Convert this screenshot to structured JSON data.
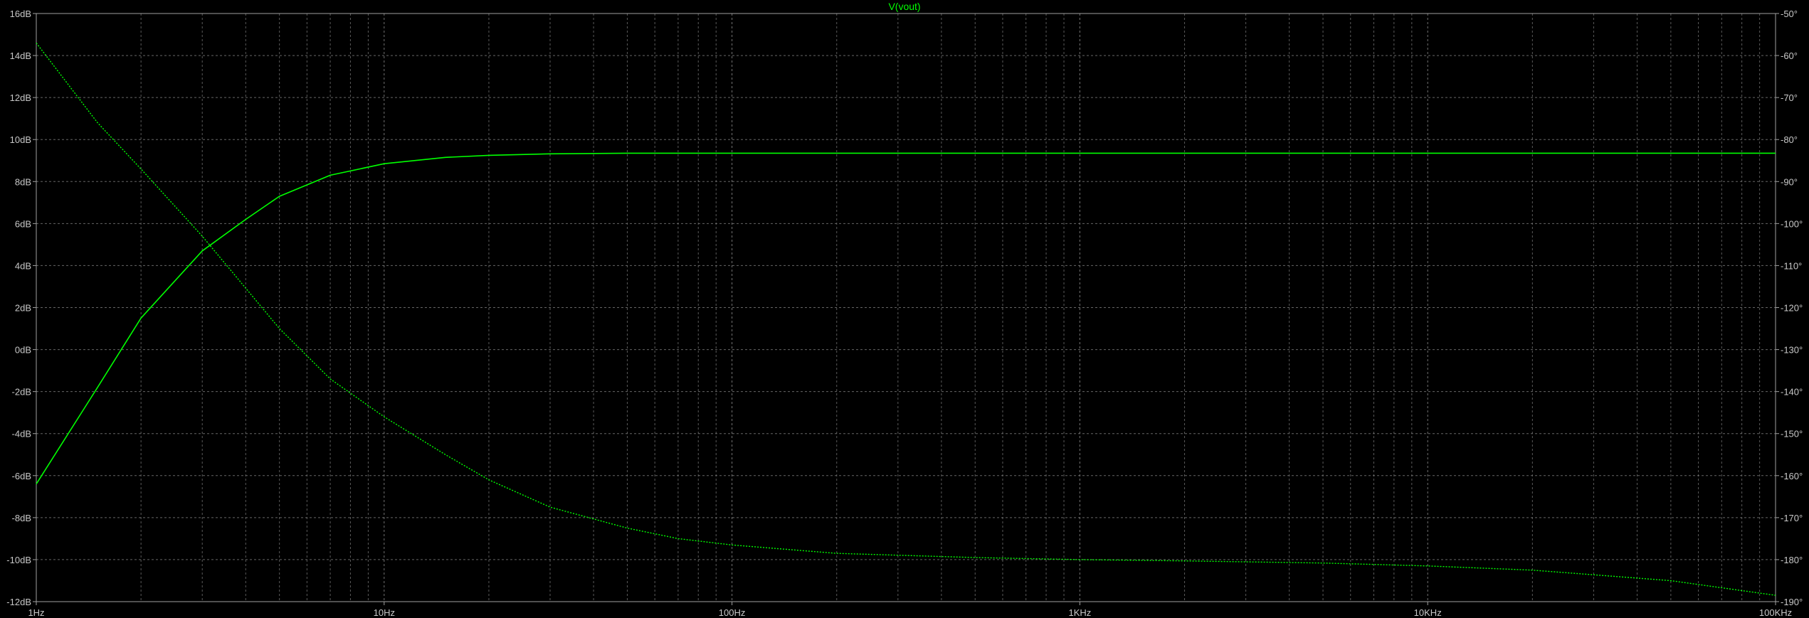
{
  "window": {
    "background": "#000000"
  },
  "colors": {
    "trace": "#00ff00",
    "grid": "#808080",
    "text": "#c8c8c8",
    "border": "#a0a0a0"
  },
  "chart_data": {
    "type": "line",
    "title": "V(vout)",
    "x_scale": "log",
    "xlim": [
      1,
      100000
    ],
    "x_ticks": [
      {
        "value": 1,
        "label": "1Hz"
      },
      {
        "value": 10,
        "label": "10Hz"
      },
      {
        "value": 100,
        "label": "100Hz"
      },
      {
        "value": 1000,
        "label": "1KHz"
      },
      {
        "value": 10000,
        "label": "10KHz"
      },
      {
        "value": 100000,
        "label": "100KHz"
      }
    ],
    "ylim_left": [
      -12,
      16
    ],
    "y_ticks_left": [
      {
        "value": 16,
        "label": "16dB"
      },
      {
        "value": 14,
        "label": "14dB"
      },
      {
        "value": 12,
        "label": "12dB"
      },
      {
        "value": 10,
        "label": "10dB"
      },
      {
        "value": 8,
        "label": "8dB"
      },
      {
        "value": 6,
        "label": "6dB"
      },
      {
        "value": 4,
        "label": "4dB"
      },
      {
        "value": 2,
        "label": "2dB"
      },
      {
        "value": 0,
        "label": "0dB"
      },
      {
        "value": -2,
        "label": "-2dB"
      },
      {
        "value": -4,
        "label": "-4dB"
      },
      {
        "value": -6,
        "label": "-6dB"
      },
      {
        "value": -8,
        "label": "-8dB"
      },
      {
        "value": -10,
        "label": "-10dB"
      },
      {
        "value": -12,
        "label": "-12dB"
      }
    ],
    "ylim_right": [
      -190,
      -50
    ],
    "y_ticks_right": [
      {
        "value": -50,
        "label": "-50°"
      },
      {
        "value": -60,
        "label": "-60°"
      },
      {
        "value": -70,
        "label": "-70°"
      },
      {
        "value": -80,
        "label": "-80°"
      },
      {
        "value": -90,
        "label": "-90°"
      },
      {
        "value": -100,
        "label": "-100°"
      },
      {
        "value": -110,
        "label": "-110°"
      },
      {
        "value": -120,
        "label": "-120°"
      },
      {
        "value": -130,
        "label": "-130°"
      },
      {
        "value": -140,
        "label": "-140°"
      },
      {
        "value": -150,
        "label": "-150°"
      },
      {
        "value": -160,
        "label": "-160°"
      },
      {
        "value": -170,
        "label": "-170°"
      },
      {
        "value": -180,
        "label": "-180°"
      },
      {
        "value": -190,
        "label": "-190°"
      }
    ],
    "grid": true,
    "series": [
      {
        "axis": "left",
        "style": "solid",
        "x": [
          1,
          1.5,
          2,
          3,
          4,
          5,
          7,
          10,
          15,
          20,
          30,
          50,
          100,
          1000,
          10000,
          100000
        ],
        "y": [
          -6.4,
          -1.8,
          1.5,
          4.7,
          6.2,
          7.3,
          8.3,
          8.85,
          9.15,
          9.25,
          9.32,
          9.35,
          9.35,
          9.35,
          9.35,
          9.35
        ]
      },
      {
        "axis": "right",
        "style": "dotted",
        "x": [
          1,
          1.5,
          2,
          3,
          5,
          7,
          10,
          15,
          20,
          30,
          50,
          70,
          100,
          200,
          500,
          1000,
          2000,
          5000,
          10000,
          20000,
          50000,
          100000
        ],
        "y": [
          -57,
          -76,
          -87,
          -103,
          -125,
          -137,
          -146,
          -155,
          -161,
          -167.5,
          -172.5,
          -175,
          -176.5,
          -178.5,
          -179.5,
          -180,
          -180.3,
          -180.8,
          -181.5,
          -182.5,
          -185,
          -188.5
        ]
      }
    ]
  }
}
